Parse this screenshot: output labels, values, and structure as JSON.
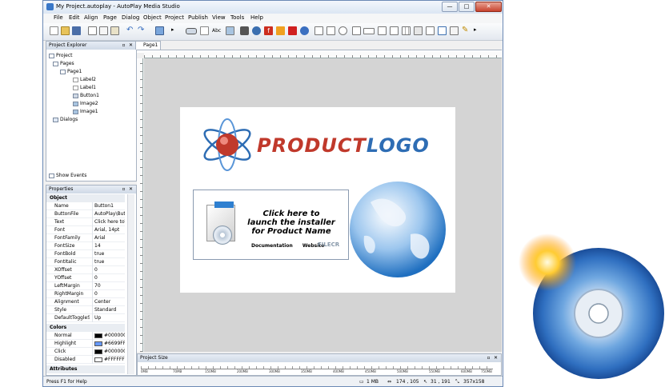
{
  "window": {
    "title": "My Project.autoplay - AutoPlay Media Studio",
    "minimize": "—",
    "maximize": "□",
    "close": "✕"
  },
  "menu": [
    "File",
    "Edit",
    "Align",
    "Page",
    "Dialog",
    "Object",
    "Project",
    "Publish",
    "View",
    "Tools",
    "Help"
  ],
  "project_explorer": {
    "title": "Project Explorer",
    "tree": [
      "Project",
      "Pages",
      "Page1",
      "Label2",
      "Label1",
      "Button1",
      "Image2",
      "Image1",
      "Dialogs"
    ],
    "show_events": "Show Events"
  },
  "properties": {
    "title": "Properties",
    "object_category": "Object",
    "rows": [
      {
        "name": "Name",
        "value": "Button1"
      },
      {
        "name": "ButtonFile",
        "value": "AutoPlay\\Butt"
      },
      {
        "name": "Text",
        "value": "Click here to\\n"
      },
      {
        "name": "Font",
        "value": "Arial, 14pt"
      },
      {
        "name": "FontFamily",
        "value": "Arial"
      },
      {
        "name": "FontSize",
        "value": "14"
      },
      {
        "name": "FontBold",
        "value": "true"
      },
      {
        "name": "FontItalic",
        "value": "true"
      },
      {
        "name": "XOffset",
        "value": "0"
      },
      {
        "name": "YOffset",
        "value": "0"
      },
      {
        "name": "LeftMargin",
        "value": "70"
      },
      {
        "name": "RightMargin",
        "value": "0"
      },
      {
        "name": "Alignment",
        "value": "Center"
      },
      {
        "name": "Style",
        "value": "Standard"
      },
      {
        "name": "DefaultToggleS",
        "value": "Up"
      }
    ],
    "colors_category": "Colors",
    "color_rows": [
      {
        "name": "Normal",
        "value": "#000000",
        "swatch": "#000000"
      },
      {
        "name": "Highlight",
        "value": "#6699FF",
        "swatch": "#6699FF"
      },
      {
        "name": "Click",
        "value": "#000000",
        "swatch": "#000000"
      },
      {
        "name": "Disabled",
        "value": "#FFFFFF",
        "swatch": "#FFFFFF"
      }
    ],
    "attributes_category": "Attributes"
  },
  "document_tab": "Page1",
  "ruler_labels": [
    "0PX",
    "50PX",
    "100PX",
    "150PX",
    "200PX",
    "250PX",
    "300PX",
    "350PX",
    "400PX",
    "450PX",
    "500PX",
    "550PX",
    "600PX",
    "650PX",
    "700PX",
    "750PX"
  ],
  "canvas": {
    "logo_product": "PRODUCT",
    "logo_logo": "LOGO",
    "button_line1": "Click here to",
    "button_line2": "launch the installer",
    "button_line3": "for Product Name",
    "link_documentation": "Documentation",
    "link_website": "Website",
    "watermark": "FILECR"
  },
  "project_size": {
    "title": "Project Size",
    "labels": [
      "0MB",
      "70MB",
      "150MB",
      "200MB",
      "300MB",
      "350MB",
      "400MB",
      "450MB",
      "500MB",
      "550MB",
      "600MB",
      "750MB"
    ]
  },
  "status": {
    "help": "Press F1 for Help",
    "size": "1 MB",
    "position": "174 , 105",
    "cursor": "31 , 191",
    "dimensions": "357x158"
  },
  "colors": {
    "accent": "#3a78c8",
    "logo_red": "#c0392b",
    "logo_blue": "#2e6db4"
  }
}
